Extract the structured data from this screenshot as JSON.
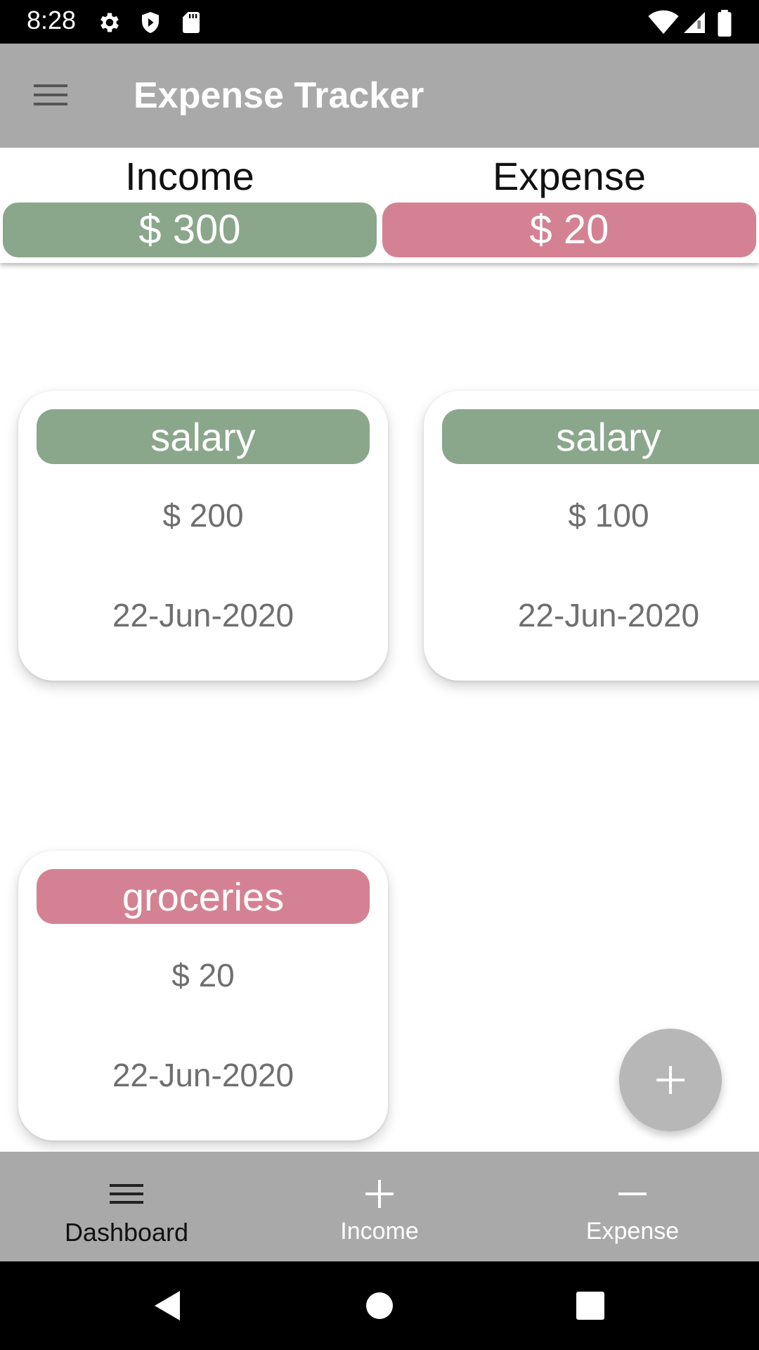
{
  "status_bar": {
    "time": "8:28",
    "icons": [
      "gear-icon",
      "shield-icon",
      "sd-card-icon",
      "wifi-icon",
      "signal-icon",
      "battery-icon"
    ]
  },
  "app_bar": {
    "title": "Expense Tracker",
    "menu_icon": "hamburger-menu-icon"
  },
  "summary": {
    "income_label": "Income",
    "income_value": "$ 300",
    "expense_label": "Expense",
    "expense_value": "$ 20"
  },
  "cards": [
    {
      "category": "salary",
      "amount": "$ 200",
      "date": "22-Jun-2020",
      "type": "income"
    },
    {
      "category": "salary",
      "amount": "$ 100",
      "date": "22-Jun-2020",
      "type": "income"
    },
    {
      "category": "groceries",
      "amount": "$ 20",
      "date": "22-Jun-2020",
      "type": "expense"
    }
  ],
  "fab": {
    "icon": "plus-icon"
  },
  "bottom_nav": {
    "items": [
      {
        "label": "Dashboard",
        "icon": "list-icon",
        "active": true
      },
      {
        "label": "Income",
        "icon": "plus-icon",
        "active": false
      },
      {
        "label": "Expense",
        "icon": "minus-icon",
        "active": false
      }
    ]
  },
  "system_nav": {
    "icons": [
      "back-icon",
      "home-icon",
      "recents-icon"
    ]
  },
  "colors": {
    "income": "#8aa78b",
    "expense": "#d48293",
    "bar": "#a9a9a9"
  }
}
